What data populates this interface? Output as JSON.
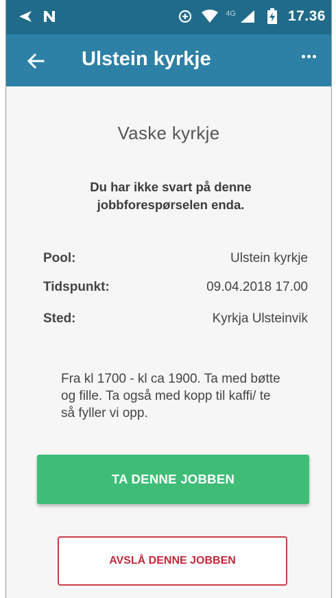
{
  "status_bar": {
    "time": "17.36",
    "network_label": "4G",
    "left_icons": [
      "send-icon",
      "n-notification-icon"
    ],
    "right_icons": [
      "data-saver-icon",
      "wifi-icon",
      "cell-signal-icon",
      "battery-charging-icon"
    ]
  },
  "toolbar": {
    "title": "Ulstein kyrkje",
    "back_icon": "arrow-back-icon",
    "menu_icon": "more-dots-icon"
  },
  "job": {
    "title": "Vaske kyrkje",
    "notice": "Du har ikke svart på denne jobbforespørselen enda.",
    "details": [
      {
        "label": "Pool:",
        "value": "Ulstein kyrkje"
      },
      {
        "label": "Tidspunkt:",
        "value": "09.04.2018 17.00"
      },
      {
        "label": "Sted:",
        "value": "Kyrkja Ulsteinvik"
      }
    ],
    "description": "Fra kl 1700 - kl ca 1900. Ta med bøtte og fille. Ta også med kopp til kaffi/ te så fyller vi opp."
  },
  "actions": {
    "accept_label": "TA DENNE JOBBEN",
    "decline_label": "AVSLÅ DENNE JOBBEN"
  },
  "colors": {
    "status_bar": "#216b8a",
    "toolbar": "#2d81a6",
    "accept": "#3fbd77",
    "decline": "#c83d45"
  }
}
